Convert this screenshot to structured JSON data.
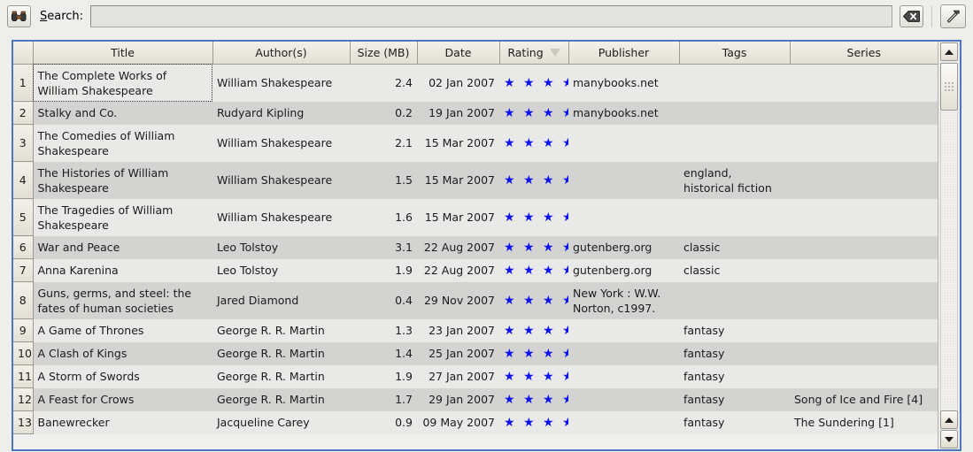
{
  "toolbar": {
    "search_icon": "binoculars-icon",
    "search_label_pre": "S",
    "search_label_post": "earch:",
    "search_value": "",
    "search_placeholder": "",
    "clear_icon": "backspace-clear-icon",
    "tools_icon": "hammer-tools-icon"
  },
  "grid": {
    "columns": [
      {
        "key": "rownum",
        "label": "",
        "sorted": false
      },
      {
        "key": "title",
        "label": "Title",
        "sorted": false
      },
      {
        "key": "author",
        "label": "Author(s)",
        "sorted": false
      },
      {
        "key": "size",
        "label": "Size (MB)",
        "sorted": false
      },
      {
        "key": "date",
        "label": "Date",
        "sorted": false
      },
      {
        "key": "rating",
        "label": "Rating",
        "sorted": true,
        "sort_dir": "descending"
      },
      {
        "key": "pub",
        "label": "Publisher",
        "sorted": false
      },
      {
        "key": "tags",
        "label": "Tags",
        "sorted": false
      },
      {
        "key": "series",
        "label": "Series",
        "sorted": false
      }
    ],
    "star_color": "#0a12ee",
    "star_glyph": "★",
    "rows": [
      {
        "n": "1",
        "title": "The Complete Works of William Shakespeare",
        "author": "William Shakespeare",
        "size": "2.4",
        "date": "02 Jan 2007",
        "rating": 5,
        "stars": "★ ★ ★ ★ ★",
        "pub": "manybooks.net",
        "tags": "",
        "series": "",
        "focused": true
      },
      {
        "n": "2",
        "title": "Stalky and Co.",
        "author": "Rudyard Kipling",
        "size": "0.2",
        "date": "19 Jan 2007",
        "rating": 5,
        "stars": "★ ★ ★ ★ ★",
        "pub": "manybooks.net",
        "tags": "",
        "series": "",
        "focused": false
      },
      {
        "n": "3",
        "title": "The Comedies of William Shakespeare",
        "author": "William Shakespeare",
        "size": "2.1",
        "date": "15 Mar 2007",
        "rating": 5,
        "stars": "★ ★ ★ ★ ★",
        "pub": "",
        "tags": "",
        "series": "",
        "focused": false
      },
      {
        "n": "4",
        "title": "The Histories of William Shakespeare",
        "author": "William Shakespeare",
        "size": "1.5",
        "date": "15 Mar 2007",
        "rating": 5,
        "stars": "★ ★ ★ ★ ★",
        "pub": "",
        "tags": "england, historical fiction",
        "series": "",
        "focused": false
      },
      {
        "n": "5",
        "title": "The Tragedies of William Shakespeare",
        "author": "William Shakespeare",
        "size": "1.6",
        "date": "15 Mar 2007",
        "rating": 5,
        "stars": "★ ★ ★ ★ ★",
        "pub": "",
        "tags": "",
        "series": "",
        "focused": false
      },
      {
        "n": "6",
        "title": "War and Peace",
        "author": "Leo Tolstoy",
        "size": "3.1",
        "date": "22 Aug 2007",
        "rating": 5,
        "stars": "★ ★ ★ ★ ★",
        "pub": "gutenberg.org",
        "tags": "classic",
        "series": "",
        "focused": false
      },
      {
        "n": "7",
        "title": "Anna Karenina",
        "author": "Leo Tolstoy",
        "size": "1.9",
        "date": "22 Aug 2007",
        "rating": 5,
        "stars": "★ ★ ★ ★ ★",
        "pub": "gutenberg.org",
        "tags": "classic",
        "series": "",
        "focused": false
      },
      {
        "n": "8",
        "title": "Guns, germs, and steel: the fates\nof human societies",
        "author": "Jared Diamond",
        "size": "0.4",
        "date": "29 Nov 2007",
        "rating": 5,
        "stars": "★ ★ ★ ★ ★",
        "pub": "New York : W.W. Norton, c1997.",
        "tags": "",
        "series": "",
        "focused": false
      },
      {
        "n": "9",
        "title": "A Game of Thrones",
        "author": "George R. R. Martin",
        "size": "1.3",
        "date": "23 Jan 2007",
        "rating": 4,
        "stars": "★ ★ ★ ★",
        "pub": "",
        "tags": "fantasy",
        "series": "",
        "focused": false
      },
      {
        "n": "10",
        "title": "A Clash of Kings",
        "author": "George R. R. Martin",
        "size": "1.4",
        "date": "25 Jan 2007",
        "rating": 4,
        "stars": "★ ★ ★ ★",
        "pub": "",
        "tags": "fantasy",
        "series": "",
        "focused": false
      },
      {
        "n": "11",
        "title": "A Storm of Swords",
        "author": "George R. R. Martin",
        "size": "1.9",
        "date": "27 Jan 2007",
        "rating": 4,
        "stars": "★ ★ ★ ★",
        "pub": "",
        "tags": "fantasy",
        "series": "",
        "focused": false
      },
      {
        "n": "12",
        "title": "A Feast for Crows",
        "author": "George R. R. Martin",
        "size": "1.7",
        "date": "29 Jan 2007",
        "rating": 4,
        "stars": "★ ★ ★ ★",
        "pub": "",
        "tags": "fantasy",
        "series": "Song of Ice and Fire [4]",
        "focused": false
      },
      {
        "n": "13",
        "title": "Banewrecker",
        "author": "Jacqueline Carey",
        "size": "0.9",
        "date": "09 May 2007",
        "rating": 4,
        "stars": "★ ★ ★ ★",
        "pub": "",
        "tags": "fantasy",
        "series": "The Sundering [1]",
        "focused": false
      }
    ]
  },
  "scrollbar": {
    "up_arrow": "arrow-up-icon",
    "down_arrow": "arrow-down-icon",
    "thumb": "scroll-thumb"
  }
}
